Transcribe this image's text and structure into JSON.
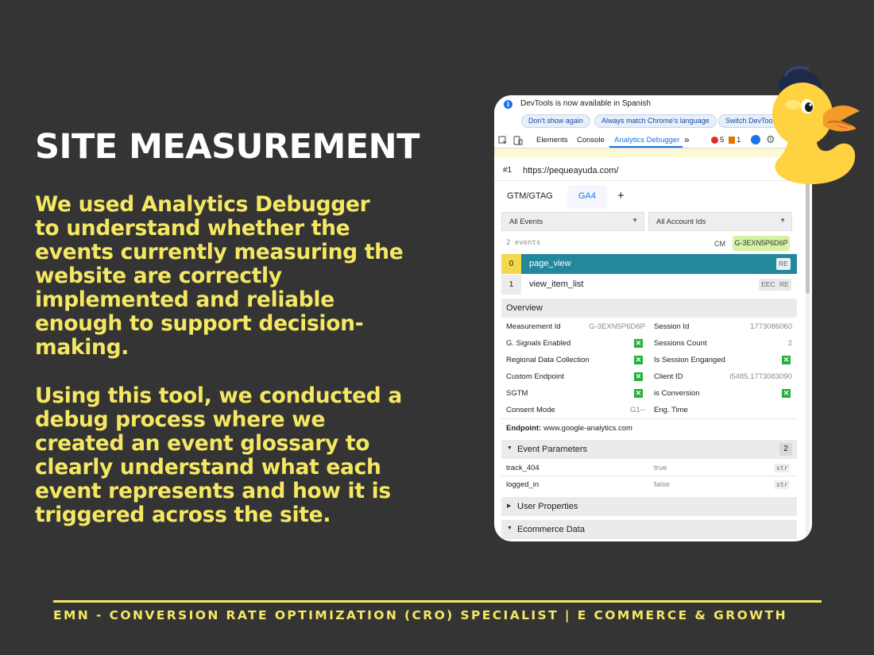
{
  "slide": {
    "title": "SITE MEASUREMENT",
    "paragraph1_lines": [
      "We used Analytics Debugger",
      "to understand whether the",
      "events currently measuring the",
      "website are correctly",
      "implemented and reliable",
      "enough to support decision-",
      "making."
    ],
    "paragraph2_lines": [
      "Using this tool, we conducted a",
      "debug process where we",
      "created an event glossary to",
      "clearly understand what each",
      "event represents and how it is",
      "triggered across the site."
    ],
    "footer": "EMN - CONVERSION RATE OPTIMIZATION (CRO) SPECIALIST | E COMMERCE & GROWTH",
    "colors": {
      "background": "#353434",
      "accent": "#f4e863",
      "title": "#ffffff"
    }
  },
  "devtools": {
    "infobar": {
      "message": "DevTools is now available in Spanish",
      "buttons": [
        "Don't show again",
        "Always match Chrome's language",
        "Switch DevTools"
      ]
    },
    "tabs": [
      "Elements",
      "Console",
      "Analytics Debugger",
      "»"
    ],
    "active_tab": "Analytics Debugger",
    "errors": "5",
    "warnings": "1",
    "page": {
      "index": "#1",
      "url": "https://pequeayuda.com/"
    },
    "subtabs": [
      "GTM/GTAG",
      "GA4",
      "+"
    ],
    "filters": {
      "events": "All Events",
      "accounts": "All Account Ids"
    },
    "events_count": "2 events",
    "cm_label": "CM",
    "measurement_badge": "G-3EXN5P6D6P",
    "events": [
      {
        "num": "0",
        "name": "page_view",
        "tags": [
          "RE"
        ]
      },
      {
        "num": "1",
        "name": "view_item_list",
        "tags": [
          "EEC",
          "RE"
        ]
      }
    ],
    "overview": {
      "title": "Overview",
      "left": [
        {
          "label": "Measurement Id",
          "value": "G-3EXN5P6D6P"
        },
        {
          "label": "G. Signals Enabled",
          "check": true
        },
        {
          "label": "Regional Data Collection",
          "check": true
        },
        {
          "label": "Custom Endpoint",
          "check": true
        },
        {
          "label": "SGTM",
          "check": true
        },
        {
          "label": "Consent Mode",
          "value": "G1--"
        }
      ],
      "right": [
        {
          "label": "Session Id",
          "value": "1773086060"
        },
        {
          "label": "Sessions Count",
          "value": "2"
        },
        {
          "label": "Is Session Enganged",
          "check": true
        },
        {
          "label": "Client ID",
          "value": "i5485.1773083090"
        },
        {
          "label": "is Conversion",
          "check": true
        },
        {
          "label": "Eng. Time",
          "value": ""
        }
      ],
      "endpoint_label": "Endpoint:",
      "endpoint_value": "www.google-analytics.com"
    },
    "event_parameters": {
      "title": "Event Parameters",
      "count": "2",
      "rows": [
        {
          "name": "track_404",
          "value": "true",
          "type": "str"
        },
        {
          "name": "logged_in",
          "value": "false",
          "type": "str"
        }
      ]
    },
    "user_properties": {
      "title": "User Properties"
    },
    "ecommerce": {
      "title": "Ecommerce Data"
    },
    "check_glyph": "✕"
  }
}
